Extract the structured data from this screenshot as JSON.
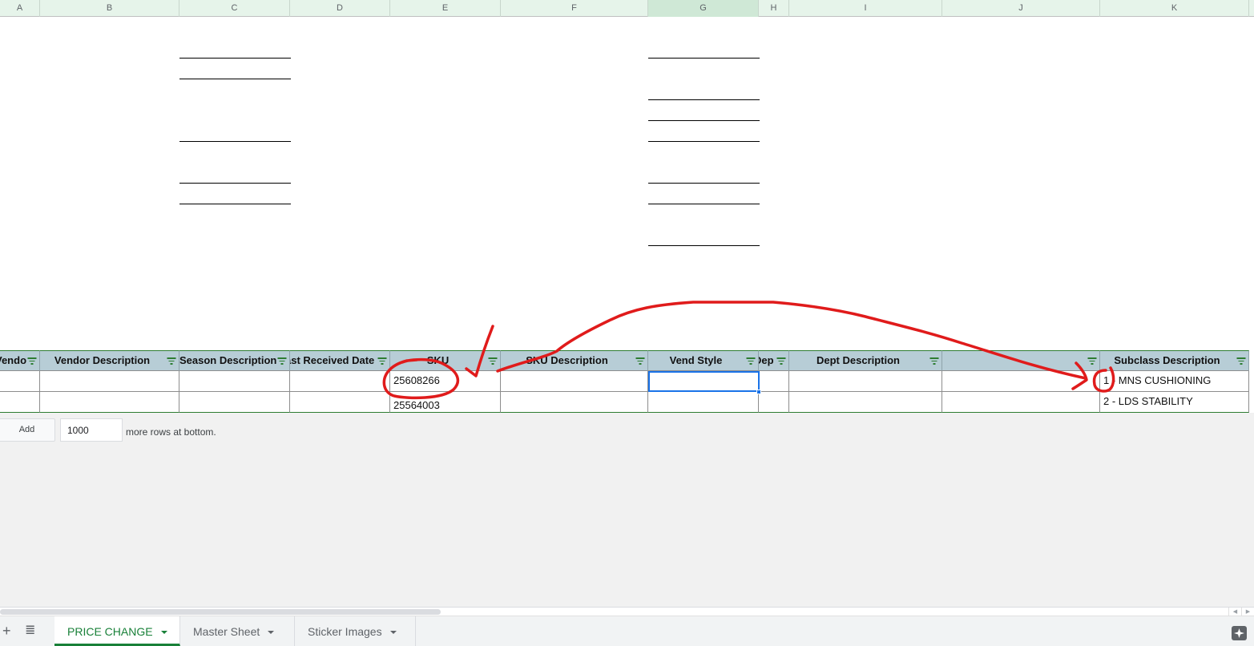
{
  "column_headers": [
    "A",
    "B",
    "C",
    "D",
    "E",
    "F",
    "G",
    "H",
    "I",
    "J",
    "K"
  ],
  "selected_column": "G",
  "table": {
    "headers": [
      {
        "label": "Vendo",
        "column": "A"
      },
      {
        "label": "Vendor Description",
        "column": "B"
      },
      {
        "label": "Season Description",
        "column": "C"
      },
      {
        "label": "ast Received Date",
        "column": "D"
      },
      {
        "label": "SKU",
        "column": "E"
      },
      {
        "label": "SKU Description",
        "column": "F"
      },
      {
        "label": "Vend Style",
        "column": "G"
      },
      {
        "label": "Dep",
        "column": "H"
      },
      {
        "label": "Dept Description",
        "column": "I"
      },
      {
        "label": "",
        "column": "J"
      },
      {
        "label": "Subclass Description",
        "column": "K"
      }
    ],
    "rows": [
      [
        "",
        "",
        "",
        "",
        "25608266",
        "",
        "",
        "",
        "",
        "",
        "1 - MNS CUSHIONING"
      ],
      [
        "",
        "",
        "",
        "",
        "25564003",
        "",
        "",
        "",
        "",
        "",
        "2 - LDS STABILITY"
      ]
    ],
    "selected_cell": {
      "row": 1,
      "column": "G"
    }
  },
  "add_rows": {
    "button_label": "Add",
    "count_value": "1000",
    "suffix_text": "more rows at bottom."
  },
  "tabs": [
    {
      "label": "PRICE CHANGE",
      "active": true
    },
    {
      "label": "Master Sheet",
      "active": false
    },
    {
      "label": "Sticker Images",
      "active": false
    }
  ],
  "icons": {
    "add_sheet": "+",
    "all_sheets": "≣",
    "scroll_left": "◀",
    "scroll_right": "▶"
  },
  "colors": {
    "accent_green": "#188038",
    "table_header_bg": "#b7cdd6",
    "selection_blue": "#1a73e8",
    "annotation_red": "#e01b1b"
  },
  "annotations": [
    {
      "type": "circle",
      "target": "SKU 25608266"
    },
    {
      "type": "checkmark",
      "target": "SKU column"
    },
    {
      "type": "arrow",
      "from": "SKU",
      "to": "Subclass Description '1'"
    },
    {
      "type": "circle",
      "target": "Subclass number 1"
    }
  ]
}
